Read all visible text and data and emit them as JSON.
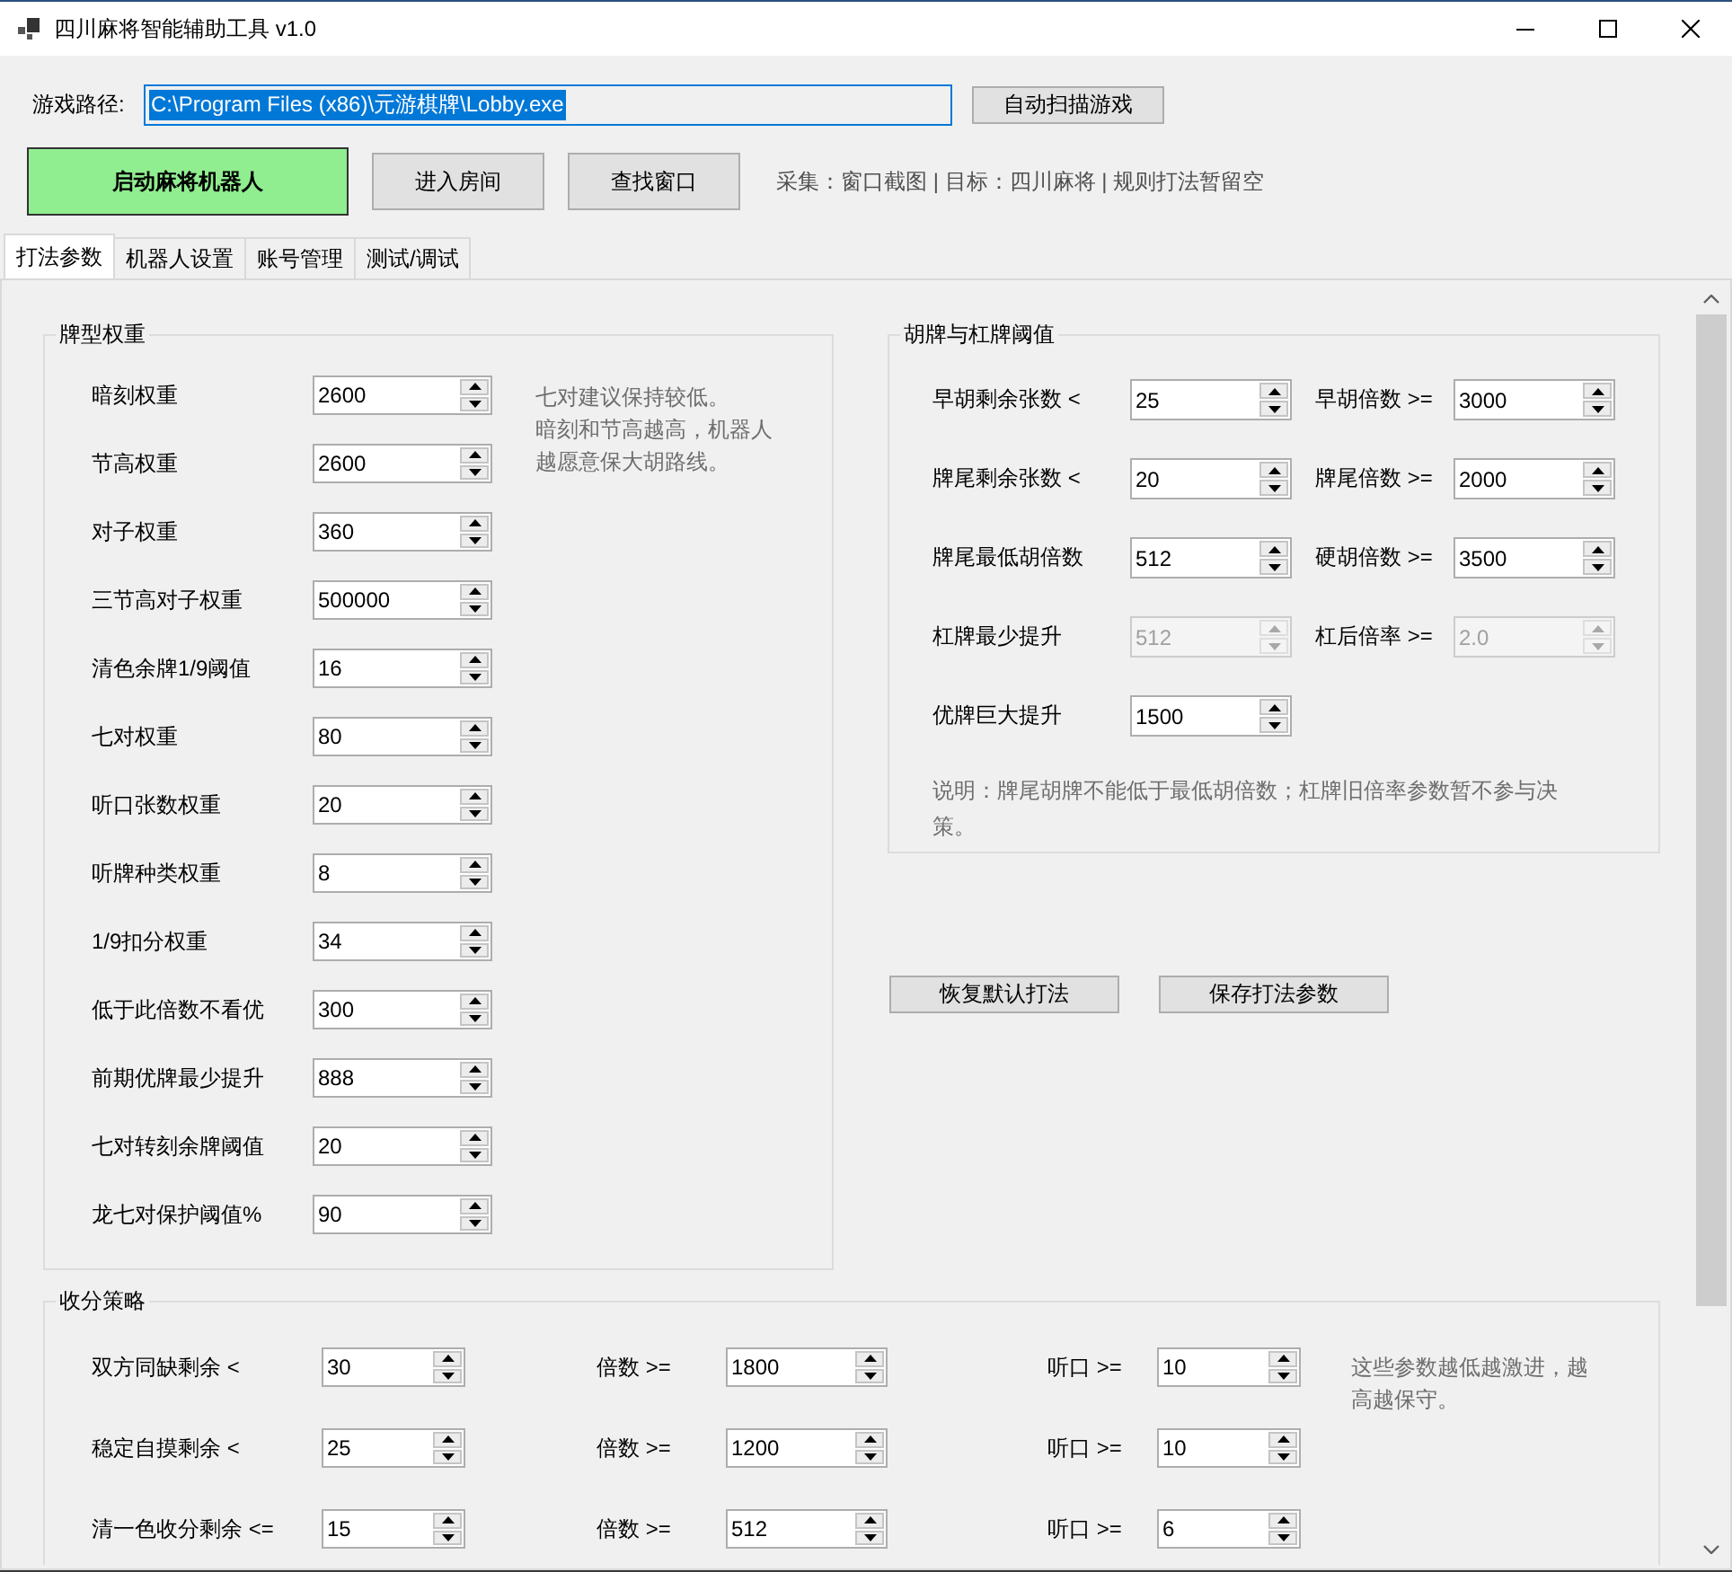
{
  "window": {
    "title": "四川麻将智能辅助工具 v1.0"
  },
  "game_path": {
    "label": "游戏路径:",
    "value": "C:\\Program Files (x86)\\元游棋牌\\Lobby.exe",
    "text_selected": true,
    "scan_button": "自动扫描游戏"
  },
  "actions": [
    {
      "label": "启动麻将机器人",
      "kind": "start"
    },
    {
      "label": "进入房间",
      "kind": "normal"
    },
    {
      "label": "查找窗口",
      "kind": "normal"
    }
  ],
  "status": "采集：窗口截图 | 目标：四川麻将 | 规则打法暂留空",
  "tabs": [
    {
      "label": "打法参数",
      "selected": true
    },
    {
      "label": "机器人设置",
      "selected": false
    },
    {
      "label": "账号管理",
      "selected": false
    },
    {
      "label": "测试/调试",
      "selected": false
    }
  ],
  "tile_weights": {
    "title": "牌型权重",
    "rows": [
      {
        "label": "暗刻权重",
        "value": "2600"
      },
      {
        "label": "节高权重",
        "value": "2600"
      },
      {
        "label": "对子权重",
        "value": "360"
      },
      {
        "label": "三节高对子权重",
        "value": "500000"
      },
      {
        "label": "清色余牌1/9阈值",
        "value": "16"
      },
      {
        "label": "七对权重",
        "value": "80"
      },
      {
        "label": "听口张数权重",
        "value": "20"
      },
      {
        "label": "听牌种类权重",
        "value": "8"
      },
      {
        "label": "1/9扣分权重",
        "value": "34"
      },
      {
        "label": "低于此倍数不看优",
        "value": "300"
      },
      {
        "label": "前期优牌最少提升",
        "value": "888"
      },
      {
        "label": "七对转刻余牌阈值",
        "value": "20"
      },
      {
        "label": "龙七对保护阈值%",
        "value": "90"
      }
    ],
    "notes": [
      "七对建议保持较低。",
      "暗刻和节高越高，机器人越愿意保大胡路线。"
    ]
  },
  "win_thresholds": {
    "title": "胡牌与杠牌阈值",
    "rows": [
      {
        "fields": [
          {
            "label": "早胡剩余张数 <",
            "value": "25",
            "disabled": false
          },
          {
            "label": "早胡倍数 >=",
            "value": "3000",
            "disabled": false
          }
        ]
      },
      {
        "fields": [
          {
            "label": "牌尾剩余张数 <",
            "value": "20",
            "disabled": false
          },
          {
            "label": "牌尾倍数 >=",
            "value": "2000",
            "disabled": false
          }
        ]
      },
      {
        "fields": [
          {
            "label": "牌尾最低胡倍数",
            "value": "512",
            "disabled": false
          },
          {
            "label": "硬胡倍数 >=",
            "value": "3500",
            "disabled": false
          }
        ]
      },
      {
        "fields": [
          {
            "label": "杠牌最少提升",
            "value": "512",
            "disabled": true
          },
          {
            "label": "杠后倍率 >=",
            "value": "2.0",
            "disabled": true
          }
        ]
      },
      {
        "fields": [
          {
            "label": "优牌巨大提升",
            "value": "1500",
            "disabled": false
          }
        ]
      }
    ],
    "note": "说明：牌尾胡牌不能低于最低胡倍数；杠牌旧倍率参数暂不参与决策。"
  },
  "buttons": [
    "恢复默认打法",
    "保存打法参数"
  ],
  "scoring": {
    "title": "收分策略",
    "rows": [
      {
        "fields": [
          {
            "label": "双方同缺剩余 <",
            "value": "30"
          },
          {
            "label": "倍数 >=",
            "value": "1800"
          },
          {
            "label": "听口 >=",
            "value": "10"
          }
        ]
      },
      {
        "fields": [
          {
            "label": "稳定自摸剩余 <",
            "value": "25"
          },
          {
            "label": "倍数 >=",
            "value": "1200"
          },
          {
            "label": "听口 >=",
            "value": "10"
          }
        ]
      },
      {
        "fields": [
          {
            "label": "清一色收分剩余 <=",
            "value": "15"
          },
          {
            "label": "倍数 >=",
            "value": "512"
          },
          {
            "label": "听口 >=",
            "value": "6"
          }
        ]
      }
    ],
    "note": "这些参数越低越激进，越高越保守。"
  }
}
